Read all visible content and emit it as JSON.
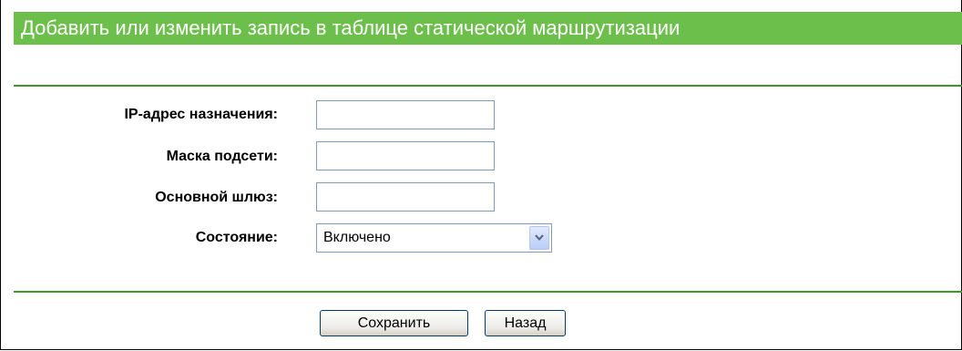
{
  "header": {
    "title": "Добавить или изменить запись в таблице статической маршрутизации"
  },
  "form": {
    "dest_ip": {
      "label": "IP-адрес назначения:",
      "value": ""
    },
    "subnet_mask": {
      "label": "Маска подсети:",
      "value": ""
    },
    "gateway": {
      "label": "Основной шлюз:",
      "value": ""
    },
    "status": {
      "label": "Состояние:",
      "selected": "Включено"
    }
  },
  "buttons": {
    "save": "Сохранить",
    "back": "Назад"
  },
  "colors": {
    "title_bar": "#6dbf4b",
    "separator": "#3c9a2a",
    "input_border": "#7f9db9"
  },
  "icons": {
    "dropdown": "chevron-down-icon"
  }
}
